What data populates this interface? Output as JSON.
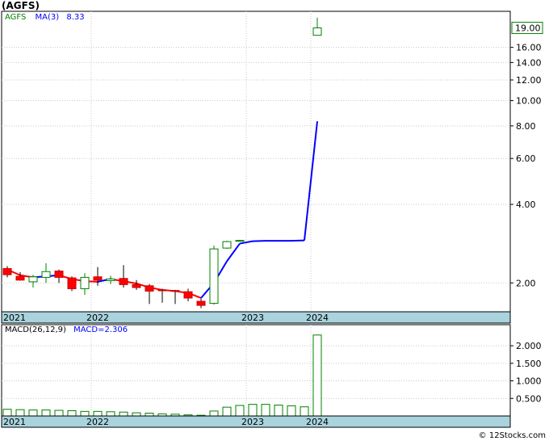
{
  "title": "(AGFS)",
  "credit": "© 12Stocks.com",
  "colors": {
    "up_candle": "#008000",
    "down_candle": "#ff0000",
    "ma_line_up": "#0000ff",
    "ma_line_down": "#ff0000",
    "axis_band": "#a9d3dd",
    "grid": "#c8c8c8",
    "last_price_box": "#008000",
    "macd_bar": "#008000",
    "ticker_text": "#008000",
    "ma_text": "#0000ff",
    "macd_text": "#0000ff"
  },
  "chart_data": [
    {
      "type": "candlestick",
      "scale": "log",
      "ticker_label": "AGFS",
      "ma_label": "MA(3)",
      "ma_value": "8.33",
      "last_price": "19.00",
      "y_ticks": [
        "2.00",
        "4.00",
        "6.00",
        "8.00",
        "10.00",
        "12.00",
        "14.00",
        "16.00"
      ],
      "y_tick_values": [
        2,
        4,
        6,
        8,
        10,
        12,
        14,
        16
      ],
      "ylim": [
        1.55,
        22
      ],
      "x_labels": [
        "2021",
        "2022",
        "2023",
        "2024"
      ],
      "x_label_positions": [
        0,
        14,
        38,
        48
      ],
      "num_slots": 49,
      "candles": [
        {
          "i": 0,
          "o": 2.27,
          "h": 2.32,
          "l": 2.1,
          "c": 2.15
        },
        {
          "i": 2,
          "o": 2.12,
          "h": 2.2,
          "l": 2.04,
          "c": 2.05
        },
        {
          "i": 4,
          "o": 2.02,
          "h": 2.15,
          "l": 1.92,
          "c": 2.11
        },
        {
          "i": 6,
          "o": 2.1,
          "h": 2.38,
          "l": 2.0,
          "c": 2.21
        },
        {
          "i": 8,
          "o": 2.22,
          "h": 2.25,
          "l": 2.0,
          "c": 2.1
        },
        {
          "i": 10,
          "o": 2.09,
          "h": 2.12,
          "l": 1.86,
          "c": 1.9
        },
        {
          "i": 12,
          "o": 1.9,
          "h": 2.18,
          "l": 1.8,
          "c": 2.1
        },
        {
          "i": 14,
          "o": 2.11,
          "h": 2.3,
          "l": 1.95,
          "c": 2.05
        },
        {
          "i": 16,
          "o": 2.04,
          "h": 2.13,
          "l": 1.98,
          "c": 2.07
        },
        {
          "i": 18,
          "o": 2.08,
          "h": 2.34,
          "l": 1.92,
          "c": 1.97
        },
        {
          "i": 20,
          "o": 1.97,
          "h": 2.05,
          "l": 1.88,
          "c": 1.92
        },
        {
          "i": 22,
          "o": 1.95,
          "h": 1.98,
          "l": 1.66,
          "c": 1.86
        },
        {
          "i": 24,
          "o": 1.88,
          "h": 1.9,
          "l": 1.68,
          "c": 1.87
        },
        {
          "i": 26,
          "o": 1.87,
          "h": 1.88,
          "l": 1.66,
          "c": 1.86
        },
        {
          "i": 28,
          "o": 1.85,
          "h": 1.9,
          "l": 1.7,
          "c": 1.75
        },
        {
          "i": 30,
          "o": 1.7,
          "h": 1.74,
          "l": 1.6,
          "c": 1.64
        },
        {
          "i": 32,
          "o": 1.67,
          "h": 2.78,
          "l": 1.65,
          "c": 2.7
        },
        {
          "i": 34,
          "o": 2.72,
          "h": 2.9,
          "l": 2.7,
          "c": 2.88
        },
        {
          "i": 36,
          "o": 2.9,
          "h": 2.92,
          "l": 2.88,
          "c": 2.91
        },
        {
          "i": 48,
          "o": 17.8,
          "h": 20.8,
          "l": 17.8,
          "c": 19.0
        }
      ],
      "ma": [
        {
          "i": 0,
          "v": 2.25
        },
        {
          "i": 2,
          "v": 2.14
        },
        {
          "i": 4,
          "v": 2.1
        },
        {
          "i": 6,
          "v": 2.12
        },
        {
          "i": 8,
          "v": 2.14
        },
        {
          "i": 10,
          "v": 2.07
        },
        {
          "i": 12,
          "v": 2.03
        },
        {
          "i": 14,
          "v": 2.02
        },
        {
          "i": 16,
          "v": 2.07
        },
        {
          "i": 18,
          "v": 2.03
        },
        {
          "i": 20,
          "v": 1.99
        },
        {
          "i": 22,
          "v": 1.92
        },
        {
          "i": 24,
          "v": 1.88
        },
        {
          "i": 26,
          "v": 1.86
        },
        {
          "i": 28,
          "v": 1.83
        },
        {
          "i": 30,
          "v": 1.75
        },
        {
          "i": 32,
          "v": 2.0
        },
        {
          "i": 34,
          "v": 2.42
        },
        {
          "i": 36,
          "v": 2.83
        },
        {
          "i": 38,
          "v": 2.89
        },
        {
          "i": 40,
          "v": 2.9
        },
        {
          "i": 42,
          "v": 2.9
        },
        {
          "i": 44,
          "v": 2.9
        },
        {
          "i": 46,
          "v": 2.91
        },
        {
          "i": 48,
          "v": 8.33
        }
      ]
    },
    {
      "type": "bar",
      "macd_label": "MACD(26,12,9)",
      "macd_value_label": "MACD=2.306",
      "y_ticks": [
        "0.500",
        "1.000",
        "1.500",
        "2.000"
      ],
      "y_tick_values": [
        0.5,
        1.0,
        1.5,
        2.0
      ],
      "ylim": [
        0,
        2.6
      ],
      "x_labels": [
        "2021",
        "2022",
        "2023",
        "2024"
      ],
      "x_label_positions": [
        0,
        14,
        38,
        48
      ],
      "num_slots": 49,
      "bars": [
        {
          "i": 0,
          "v": 0.19
        },
        {
          "i": 2,
          "v": 0.18
        },
        {
          "i": 4,
          "v": 0.17
        },
        {
          "i": 6,
          "v": 0.17
        },
        {
          "i": 8,
          "v": 0.16
        },
        {
          "i": 10,
          "v": 0.15
        },
        {
          "i": 12,
          "v": 0.13
        },
        {
          "i": 14,
          "v": 0.13
        },
        {
          "i": 16,
          "v": 0.12
        },
        {
          "i": 18,
          "v": 0.11
        },
        {
          "i": 20,
          "v": 0.09
        },
        {
          "i": 22,
          "v": 0.08
        },
        {
          "i": 24,
          "v": 0.06
        },
        {
          "i": 26,
          "v": 0.05
        },
        {
          "i": 28,
          "v": 0.03
        },
        {
          "i": 30,
          "v": 0.02
        },
        {
          "i": 32,
          "v": 0.14
        },
        {
          "i": 34,
          "v": 0.25
        },
        {
          "i": 36,
          "v": 0.3
        },
        {
          "i": 38,
          "v": 0.33
        },
        {
          "i": 40,
          "v": 0.33
        },
        {
          "i": 42,
          "v": 0.31
        },
        {
          "i": 44,
          "v": 0.29
        },
        {
          "i": 46,
          "v": 0.26
        },
        {
          "i": 48,
          "v": 2.306
        }
      ]
    }
  ]
}
